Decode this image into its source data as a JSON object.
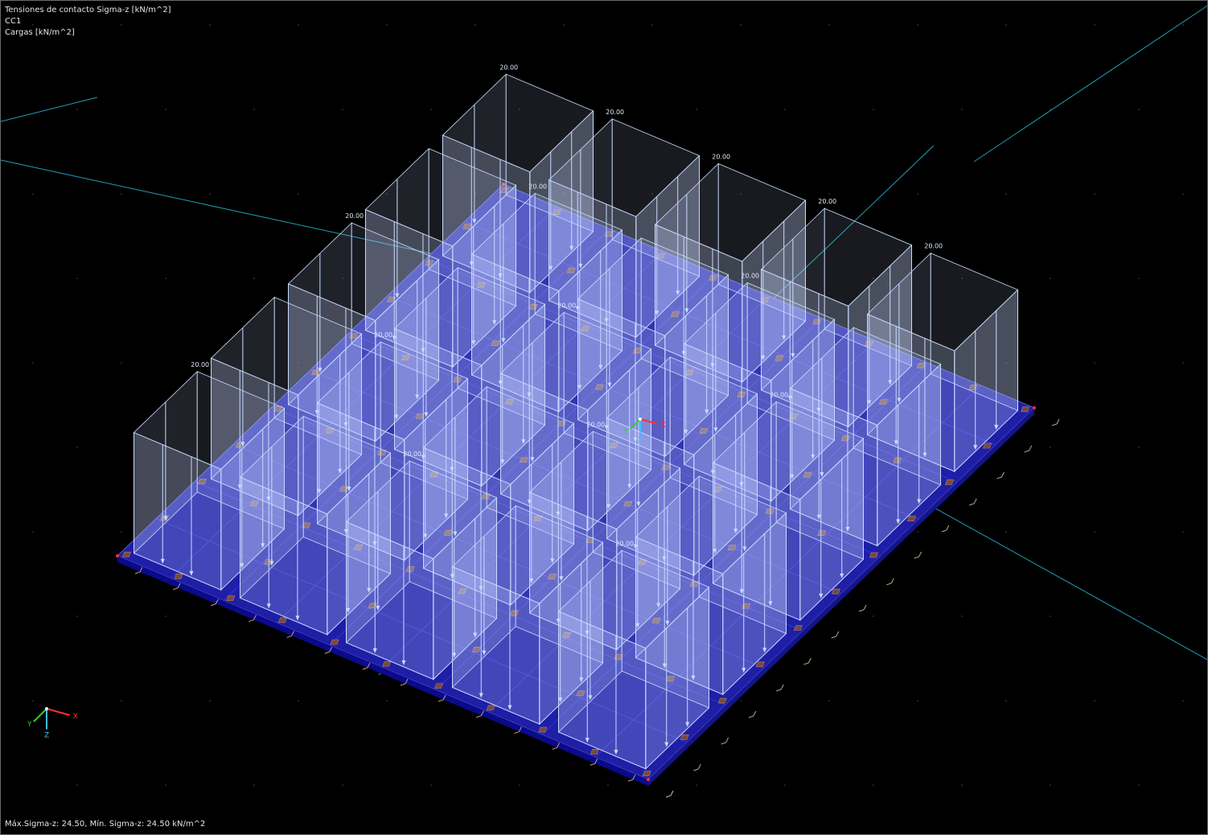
{
  "header": {
    "title": "Tensiones de contacto Sigma-z [kN/m^2]",
    "load_case": "CC1",
    "loads": "Cargas [kN/m^2]"
  },
  "footer": {
    "result_summary": "Máx.Sigma-z: 24.50, Mín. Sigma-z: 24.50 kN/m^2"
  },
  "loads": {
    "value_label": "20.00",
    "cols": 5,
    "rows": 5
  },
  "axes": {
    "x": "X",
    "y": "Y",
    "z": "Z"
  },
  "colors": {
    "background": "#000000",
    "slab": "#1e1ea6",
    "slab_edge": "#0a0a8a",
    "load_box": "#c8d6ff",
    "load_edge": "#c8dcff",
    "grid_line": "#1ea0b4",
    "support": "#7a4a3a",
    "axis_x": "#ff3030",
    "axis_y": "#30d030",
    "axis_z": "#40c0ff"
  }
}
